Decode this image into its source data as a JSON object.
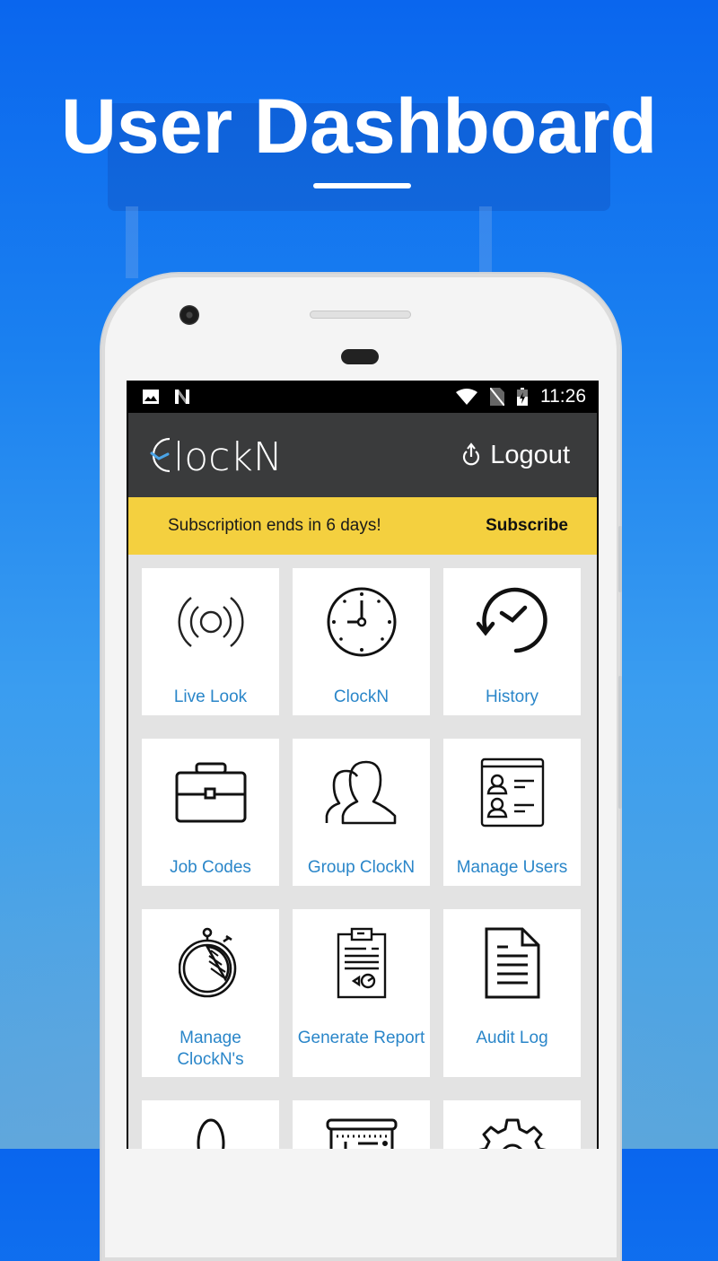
{
  "headline": "User Dashboard",
  "status_bar": {
    "time": "11:26",
    "icons": [
      "image-notification-icon",
      "n-notification-icon",
      "wifi-icon",
      "no-sim-icon",
      "battery-charging-icon"
    ]
  },
  "app_bar": {
    "logo_text": "ClockN",
    "logout_label": "Logout",
    "logout_icon": "power-icon",
    "logo_accent_color": "#4aa3e6"
  },
  "banner": {
    "message": "Subscription ends in 6 days!",
    "action_label": "Subscribe",
    "background_color": "#f4d03f"
  },
  "tiles": [
    {
      "label": "Live Look",
      "icon": "broadcast-icon"
    },
    {
      "label": "ClockN",
      "icon": "clock-icon"
    },
    {
      "label": "History",
      "icon": "history-icon"
    },
    {
      "label": "Job Codes",
      "icon": "briefcase-icon"
    },
    {
      "label": "Group ClockN",
      "icon": "group-icon"
    },
    {
      "label": "Manage Users",
      "icon": "user-list-icon"
    },
    {
      "label": "Manage\nClockN's",
      "icon": "stopwatch-icon"
    },
    {
      "label": "Generate Report",
      "icon": "report-icon"
    },
    {
      "label": "Audit Log",
      "icon": "document-icon"
    },
    {
      "label": "",
      "icon": "person-icon"
    },
    {
      "label": "",
      "icon": "invoice-icon"
    },
    {
      "label": "",
      "icon": "gear-icon"
    }
  ],
  "colors": {
    "tile_label": "#2a86c9",
    "app_bar": "#3a3b3c"
  }
}
